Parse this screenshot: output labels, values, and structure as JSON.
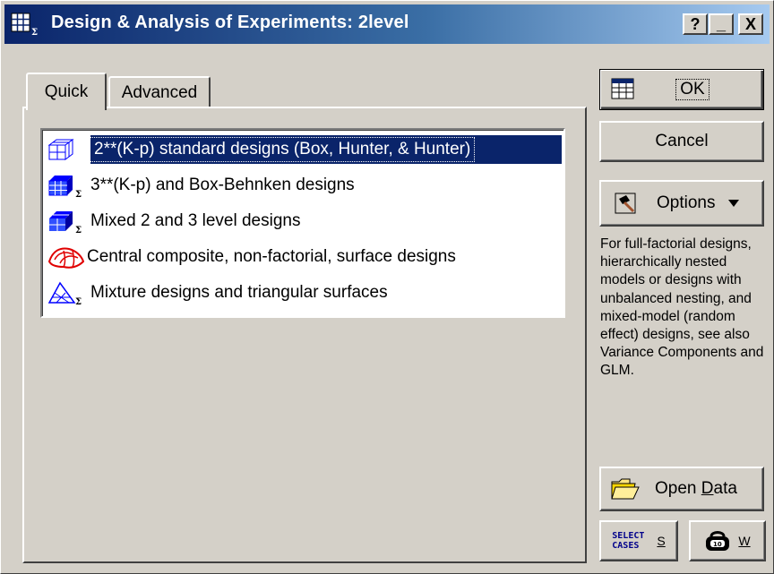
{
  "window": {
    "title": "Design & Analysis of Experiments: 2level",
    "help_label": "?",
    "minimize_label": "_",
    "close_label": "X"
  },
  "tabs": [
    {
      "label": "Quick",
      "active": true
    },
    {
      "label": "Advanced",
      "active": false
    }
  ],
  "design_list": {
    "items": [
      {
        "label": "2**(K-p) standard designs (Box, Hunter, & Hunter)",
        "icon": "cube-grid-sigma-icon",
        "selected": true
      },
      {
        "label": "3**(K-p) and Box-Behnken designs",
        "icon": "grid-sigma-icon",
        "selected": false
      },
      {
        "label": "Mixed 2 and 3 level designs",
        "icon": "mixed-cube-sigma-icon",
        "selected": false
      },
      {
        "label": "Central composite, non-factorial, surface designs",
        "icon": "surface-icon",
        "selected": false
      },
      {
        "label": "Mixture designs and triangular surfaces",
        "icon": "triangle-sigma-icon",
        "selected": false
      }
    ]
  },
  "buttons": {
    "ok_label": "OK",
    "cancel_label": "Cancel",
    "options_label": "Options",
    "open_data_prefix": "Open ",
    "open_data_underlined": "D",
    "open_data_suffix": "ata",
    "select_cases_line1": "SELECT",
    "select_cases_line2": "CASES",
    "select_cases_key": "S",
    "weights_key": "W"
  },
  "help_text": "For full-factorial designs, hierarchically nested models or designs with unbalanced nesting, and mixed-model (random effect) designs, see also Variance Components and GLM.",
  "colors": {
    "title_start": "#0a246a",
    "title_end": "#a6caf0",
    "selection": "#0a246a",
    "face": "#d4d0c8"
  }
}
